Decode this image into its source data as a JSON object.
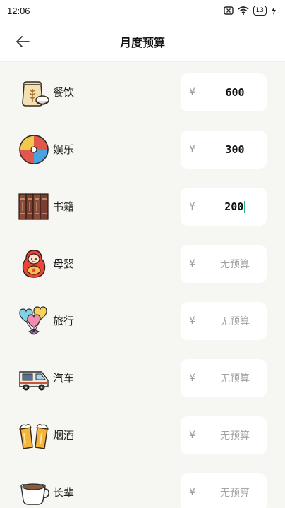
{
  "status_bar": {
    "time": "12:06",
    "battery": "13"
  },
  "header": {
    "title": "月度预算"
  },
  "currency_symbol": "¥",
  "categories": [
    {
      "label": "餐饮",
      "value": "600",
      "icon": "rice-sack-icon"
    },
    {
      "label": "娱乐",
      "value": "300",
      "icon": "beach-ball-icon"
    },
    {
      "label": "书籍",
      "value": "200",
      "icon": "books-icon"
    },
    {
      "label": "母婴",
      "value": "无预算",
      "icon": "doll-icon"
    },
    {
      "label": "旅行",
      "value": "无预算",
      "icon": "heart-balloons-icon"
    },
    {
      "label": "汽车",
      "value": "无预算",
      "icon": "camper-van-icon"
    },
    {
      "label": "烟酒",
      "value": "无预算",
      "icon": "beer-mugs-icon"
    },
    {
      "label": "长辈",
      "value": "无预算",
      "icon": "coffee-cup-icon"
    }
  ],
  "colors": {
    "accent_caret": "#2fb77a",
    "background": "#f6f6f2"
  }
}
